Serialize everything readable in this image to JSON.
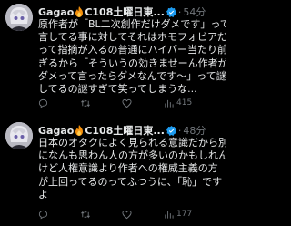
{
  "posts": [
    {
      "author": "Gagao",
      "handle_text": "C108土曜日東...",
      "time": "54分",
      "lines": [
        "原作者が「BL二次創作だけダメです」って公",
        "言してる事に対してそれはホモフォビアだろ",
        "って指摘が入るの普通にハイパー当たり前す",
        "ぎるから「そういうの効きませーん作者が",
        "ダメって言ったらダメなんです〜」って謎擁護",
        "してるの謎すぎて笑ってしまうな..."
      ],
      "stats": {
        "replies": "",
        "reposts": "",
        "likes": "",
        "views": "415"
      }
    },
    {
      "author": "Gagao",
      "handle_text": "C108土曜日東...",
      "time": "48分",
      "lines": [
        "日本のオタクによく見られる意識だから別",
        "になんも思わん人の方が多いのかもしれん",
        "けど人権意識より作者への権威主義の方",
        "が上回ってるのってふつうに、「恥」です",
        "よ"
      ],
      "stats": {
        "replies": "",
        "reposts": "",
        "likes": "",
        "views": "177"
      }
    }
  ],
  "colors": {
    "background": "#000000",
    "text": "#e7e9ea",
    "muted": "#71767b",
    "verified": "#1d9bf0",
    "flame": "#f4900c"
  }
}
